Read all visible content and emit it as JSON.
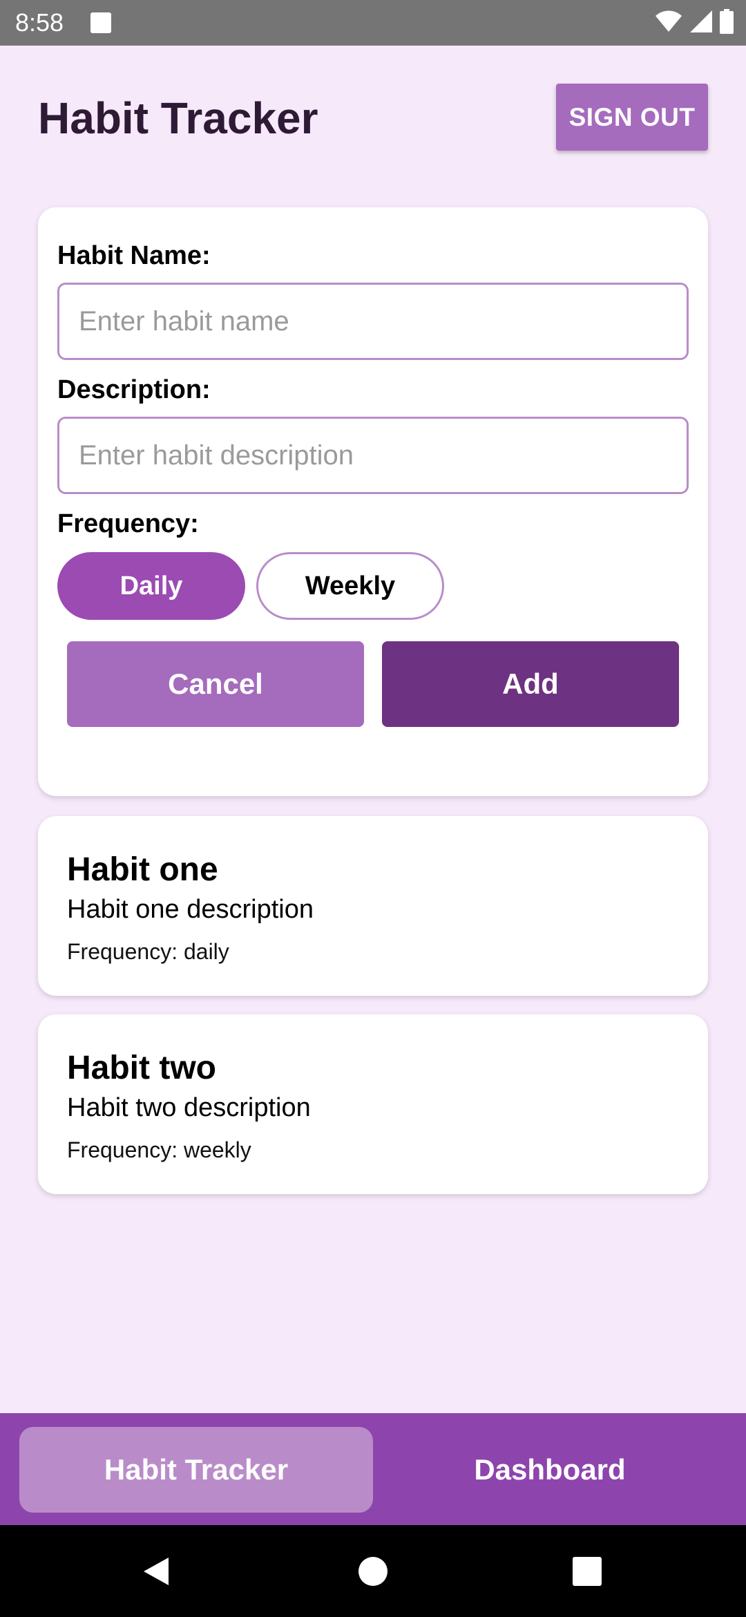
{
  "status_bar": {
    "time": "8:58",
    "icons": [
      "notification-square-icon",
      "wifi-icon",
      "signal-icon",
      "battery-icon"
    ]
  },
  "header": {
    "title": "Habit Tracker",
    "sign_out_label": "SIGN OUT"
  },
  "form": {
    "habit_name_label": "Habit Name:",
    "habit_name_value": "",
    "habit_name_placeholder": "Enter habit name",
    "description_label": "Description:",
    "description_value": "",
    "description_placeholder": "Enter habit description",
    "frequency_label": "Frequency:",
    "frequency_options": [
      {
        "label": "Daily",
        "selected": true
      },
      {
        "label": "Weekly",
        "selected": false
      }
    ],
    "cancel_label": "Cancel",
    "add_label": "Add"
  },
  "habits": [
    {
      "name": "Habit one",
      "description": "Habit one description",
      "frequency_text": "Frequency: daily"
    },
    {
      "name": "Habit two",
      "description": "Habit two description",
      "frequency_text": "Frequency: weekly"
    }
  ],
  "bottom_nav": {
    "tabs": [
      {
        "label": "Habit Tracker",
        "active": true
      },
      {
        "label": "Dashboard",
        "active": false
      }
    ]
  },
  "system_nav": {
    "icons": [
      "back-icon",
      "home-icon",
      "recents-icon"
    ]
  },
  "colors": {
    "background": "#f6e9fa",
    "primary": "#8e44ad",
    "primary_dark": "#6e3282",
    "primary_light": "#a56bbd",
    "accent_selected": "#9c4bb3",
    "border": "#b98cc9"
  }
}
